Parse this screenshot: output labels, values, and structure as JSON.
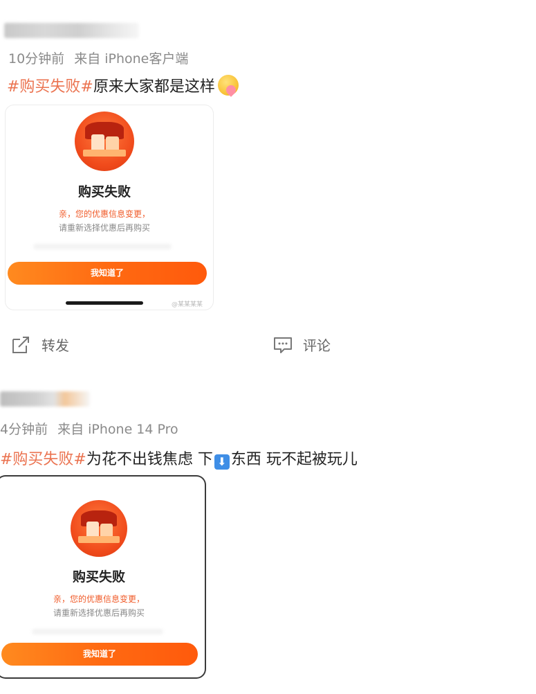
{
  "posts": [
    {
      "time": "10分钟前",
      "source": "来自 iPhone客户端",
      "tag": "#购买失败#",
      "text": "原来大家都是这样",
      "emoji_icon": "savoring-face-emoji",
      "card": {
        "title": "购买失败",
        "line1": "亲，您的优惠信息变更，",
        "line2": "请重新选择优惠后再购买",
        "button": "我知道了",
        "watermark": "@某某某某"
      }
    },
    {
      "time": "4分钟前",
      "source": "来自 iPhone 14 Pro",
      "tag": "#购买失败#",
      "text_a": "为花不出钱焦虑 下",
      "down_icon": "⬇",
      "text_b": "东西 玩不起被玩儿",
      "card": {
        "title": "购买失败",
        "line1": "亲，您的优惠信息变更，",
        "line2": "请重新选择优惠后再购买",
        "button": "我知道了"
      }
    }
  ],
  "actions": {
    "repost": "转发",
    "comment": "评论"
  },
  "colors": {
    "tag": "#eb7350",
    "button_gradient_start": "#ff8a1f",
    "button_gradient_end": "#ff5a0c",
    "card_highlight": "#f05a28"
  }
}
